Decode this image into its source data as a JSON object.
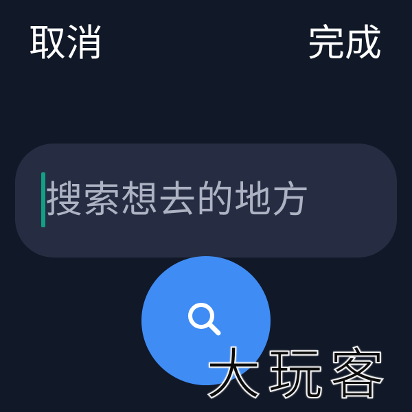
{
  "header": {
    "cancel_label": "取消",
    "done_label": "完成"
  },
  "search": {
    "placeholder": "搜索想去的地方",
    "value": ""
  },
  "search_button": {
    "icon": "search-icon"
  },
  "watermark": {
    "text": "大玩客"
  },
  "colors": {
    "background": "#111827",
    "input_background": "#262d43",
    "caret": "#12a085",
    "accent": "#3f8cf4",
    "placeholder_text": "#aeb3c3",
    "header_text": "#ffffff"
  }
}
